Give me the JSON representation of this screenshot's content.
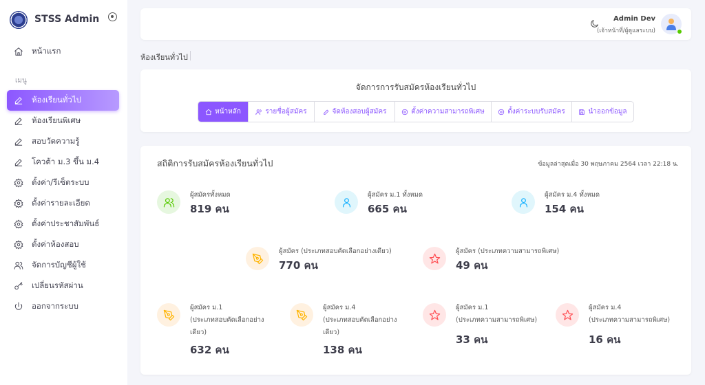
{
  "sidebar": {
    "brand": "STSS Admin",
    "home": "หน้าแรก",
    "section_label": "เมนู",
    "items": [
      {
        "label": "ห้องเรียนทั่วไป"
      },
      {
        "label": "ห้องเรียนพิเศษ"
      },
      {
        "label": "สอบวัดความรู้"
      },
      {
        "label": "โควต้า ม.3 ขึ้น ม.4"
      },
      {
        "label": "ตั้งค่า/รีเซ็ตระบบ"
      },
      {
        "label": "ตั้งค่ารายละเอียด"
      },
      {
        "label": "ตั้งค่าประชาสัมพันธ์"
      },
      {
        "label": "ตั้งค่าห้องสอบ"
      },
      {
        "label": "จัดการบัญชีผู้ใช้"
      },
      {
        "label": "เปลี่ยนรหัสผ่าน"
      },
      {
        "label": "ออกจากระบบ"
      }
    ]
  },
  "header": {
    "user_name": "Admin Dev",
    "user_role": "(เจ้าหน้าที่/ผู้ดูแลระบบ)"
  },
  "breadcrumb": "ห้องเรียนทั่วไป",
  "manage": {
    "title": "จัดการการรับสมัครห้องเรียนทั่วไป",
    "tabs": [
      {
        "label": "หน้าหลัก"
      },
      {
        "label": "รายชื่อผู้สมัคร"
      },
      {
        "label": "จัดห้องสอบผู้สมัคร"
      },
      {
        "label": "ตั้งค่าความสามารถพิเศษ"
      },
      {
        "label": "ตั้งค่าระบบรับสมัคร"
      },
      {
        "label": "นำออกข้อมูล"
      }
    ]
  },
  "stats": {
    "title": "สถิติการรับสมัครห้องเรียนทั่วไป",
    "updated": "ข้อมูลล่าสุดเมื่อ 30 พฤษภาคม 2564 เวลา 22:18 น.",
    "total": {
      "label": "ผู้สมัครทั้งหมด",
      "value": "819 คน"
    },
    "m1_total": {
      "label": "ผู้สมัคร ม.1 ทั้งหมด",
      "value": "665 คน"
    },
    "m4_total": {
      "label": "ผู้สมัคร ม.4 ทั้งหมด",
      "value": "154 คน"
    },
    "selection": {
      "label": "ผู้สมัคร (ประเภทสอบคัดเลือกอย่างเดียว)",
      "value": "770 คน"
    },
    "talent": {
      "label": "ผู้สมัคร (ประเภทความสามารถพิเศษ)",
      "value": "49 คน"
    },
    "m1_selection": {
      "label1": "ผู้สมัคร ม.1",
      "label2": "(ประเภทสอบคัดเลือกอย่าง",
      "label3": "เดียว)",
      "value": "632 คน"
    },
    "m4_selection": {
      "label1": "ผู้สมัคร ม.4",
      "label2": "(ประเภทสอบคัดเลือกอย่าง",
      "label3": "เดียว)",
      "value": "138 คน"
    },
    "m1_talent": {
      "label1": "ผู้สมัคร ม.1",
      "label2": "(ประเภทความสามารถพิเศษ)",
      "value": "33 คน"
    },
    "m4_talent": {
      "label1": "ผู้สมัคร ม.4",
      "label2": "(ประเภทความสามารถพิเศษ)",
      "value": "16 คน"
    }
  },
  "colors": {
    "accent": "#8c57ff",
    "green": "#56ca00",
    "cyan": "#16b1ff",
    "orange": "#ffb400",
    "red": "#ff4c51"
  }
}
